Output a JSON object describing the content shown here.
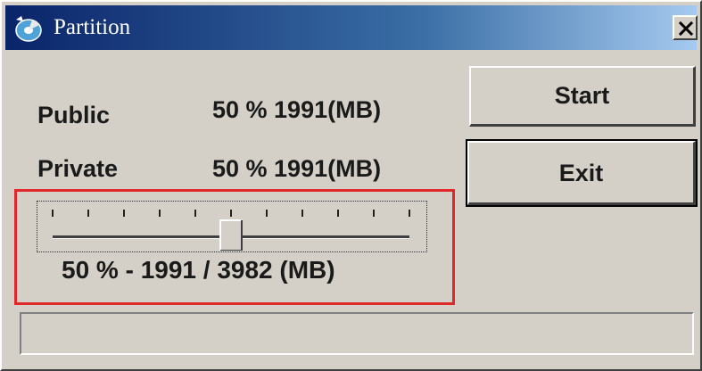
{
  "window": {
    "title": "Partition",
    "icon": "disk-partition-icon",
    "close_icon": "close-icon"
  },
  "partitions": {
    "public_label": "Public",
    "public_value": "50 % 1991(MB)",
    "private_label": "Private",
    "private_value": "50 % 1991(MB)"
  },
  "buttons": {
    "start_label": "Start",
    "exit_label": "Exit"
  },
  "slider": {
    "value_percent": 50,
    "tick_count": 11,
    "readout": "50 % - 1991 / 3982 (MB)"
  },
  "status": {
    "text": ""
  },
  "colors": {
    "title_gradient_start": "#0a246a",
    "title_gradient_end": "#a6caf0",
    "highlight_border": "#e0282a",
    "face": "#d4d0c8"
  }
}
